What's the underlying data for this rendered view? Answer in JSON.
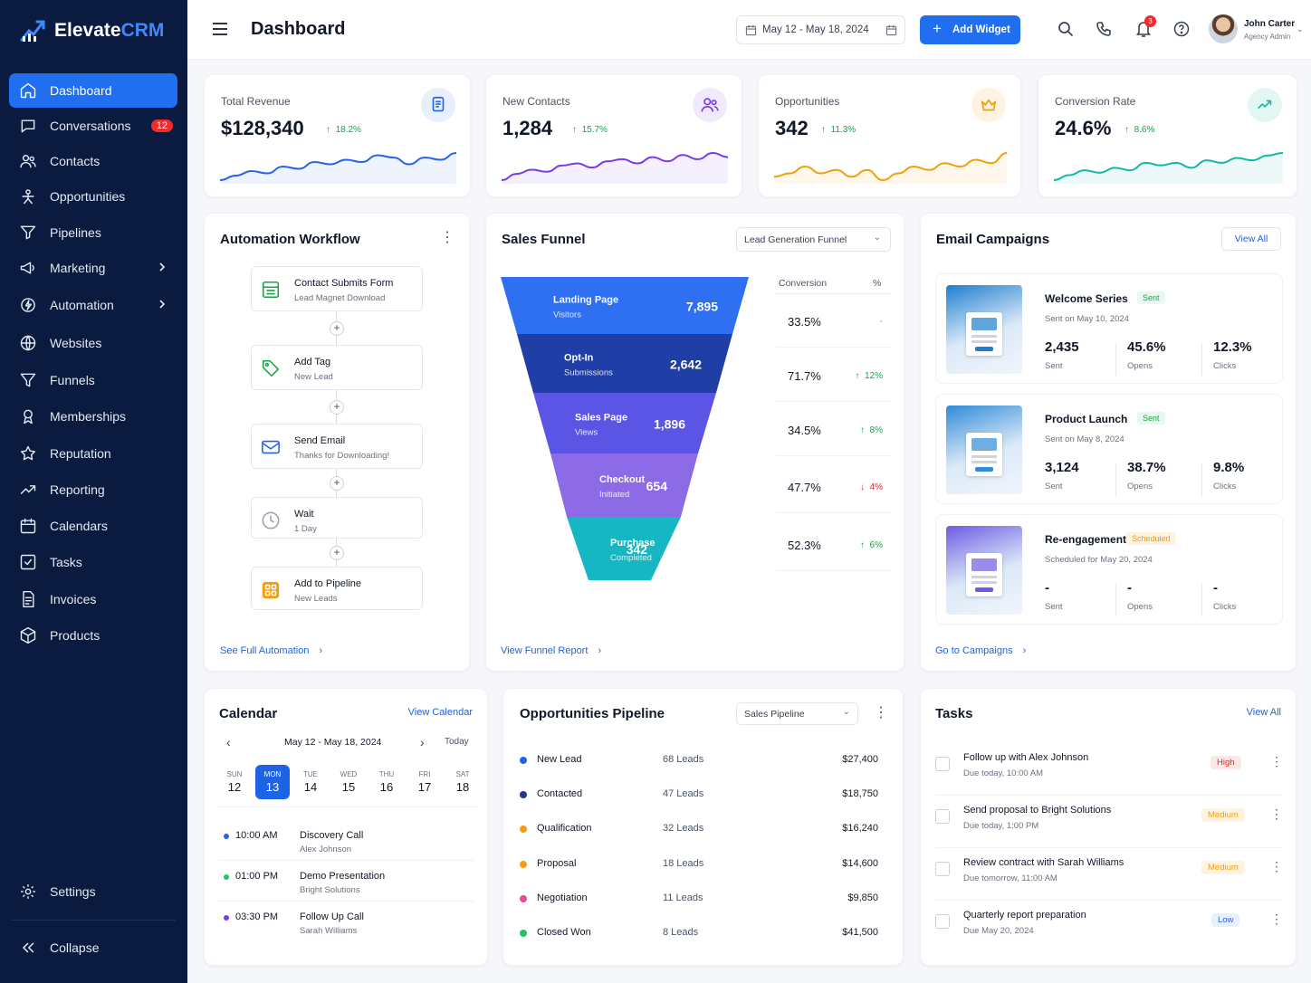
{
  "app": {
    "brand_main": "Elevate",
    "brand_accent": "CRM",
    "accent_color": "#1f6ff0"
  },
  "sidebar": {
    "items": [
      {
        "label": "Dashboard",
        "icon": "home-icon",
        "active": true
      },
      {
        "label": "Conversations",
        "icon": "chat-icon",
        "badge": "12"
      },
      {
        "label": "Contacts",
        "icon": "users-icon"
      },
      {
        "label": "Opportunities",
        "icon": "opportunity-icon"
      },
      {
        "label": "Pipelines",
        "icon": "pipeline-icon"
      },
      {
        "label": "Marketing",
        "icon": "megaphone-icon",
        "expandable": true
      },
      {
        "label": "Automation",
        "icon": "automation-icon",
        "expandable": true
      },
      {
        "label": "Websites",
        "icon": "globe-icon"
      },
      {
        "label": "Funnels",
        "icon": "funnel-icon"
      },
      {
        "label": "Memberships",
        "icon": "membership-icon"
      },
      {
        "label": "Reputation",
        "icon": "star-icon"
      },
      {
        "label": "Reporting",
        "icon": "trend-icon"
      },
      {
        "label": "Calendars",
        "icon": "calendar-icon"
      },
      {
        "label": "Tasks",
        "icon": "checkbox-icon"
      },
      {
        "label": "Invoices",
        "icon": "invoice-icon"
      },
      {
        "label": "Products",
        "icon": "box-icon"
      }
    ],
    "settings": "Settings",
    "collapse": "Collapse"
  },
  "header": {
    "title": "Dashboard",
    "date_range": "May 12 - May 18, 2024",
    "add_widget": "Add Widget",
    "notification_count": "3",
    "user_name": "John Carter",
    "user_role": "Agency Admin"
  },
  "kpis": [
    {
      "label": "Total Revenue",
      "value": "$128,340",
      "delta": "18.2%",
      "color": "#2563eb",
      "icon": "document-icon",
      "trend": [
        3,
        5,
        7,
        6,
        9,
        8,
        11,
        10,
        12,
        11,
        14,
        13,
        10,
        13,
        12,
        15
      ]
    },
    {
      "label": "New Contacts",
      "value": "1,284",
      "delta": "15.7%",
      "color": "#7c3aed",
      "icon": "users-icon",
      "trend": [
        2,
        5,
        7,
        6,
        9,
        10,
        8,
        11,
        12,
        10,
        13,
        11,
        14,
        12,
        15,
        13
      ]
    },
    {
      "label": "Opportunities",
      "value": "342",
      "delta": "11.3%",
      "color": "#f59e0b",
      "icon": "crown-icon",
      "trend": [
        5,
        6,
        8,
        6,
        7,
        5,
        7,
        4,
        6,
        8,
        7,
        9,
        8,
        10,
        9,
        12
      ]
    },
    {
      "label": "Conversion Rate",
      "value": "24.6%",
      "delta": "8.6%",
      "color": "#14b8a6",
      "icon": "trend-up-icon",
      "trend": [
        2,
        4,
        6,
        5,
        7,
        6,
        9,
        8,
        9,
        7,
        10,
        9,
        11,
        10,
        12,
        13
      ]
    }
  ],
  "automation": {
    "title": "Automation Workflow",
    "nodes": [
      {
        "title": "Contact Submits Form",
        "sub": "Lead Magnet Download",
        "icon": "form-icon",
        "color": "#16a34a"
      },
      {
        "title": "Add Tag",
        "sub": "New Lead",
        "icon": "tag-icon",
        "color": "#16a34a"
      },
      {
        "title": "Send Email",
        "sub": "Thanks for Downloading!",
        "icon": "mail-icon",
        "color": "#2563eb"
      },
      {
        "title": "Wait",
        "sub": "1 Day",
        "icon": "clock-icon",
        "color": "#9ca3af"
      },
      {
        "title": "Add to Pipeline",
        "sub": "New Leads",
        "icon": "pipeline-grid-icon",
        "color": "#f59e0b"
      }
    ],
    "link": "See Full Automation"
  },
  "funnel": {
    "title": "Sales Funnel",
    "select": "Lead Generation Funnel",
    "col_conversion": "Conversion",
    "col_pct": "%",
    "stages": [
      {
        "name": "Landing Page",
        "sub": "Visitors",
        "value": "7,895",
        "conversion": "33.5%",
        "delta": "-",
        "dir": "none",
        "color": "#2f6ff2"
      },
      {
        "name": "Opt-In",
        "sub": "Submissions",
        "value": "2,642",
        "conversion": "71.7%",
        "delta": "12%",
        "dir": "up",
        "color": "#1f3fa6"
      },
      {
        "name": "Sales Page",
        "sub": "Views",
        "value": "1,896",
        "conversion": "34.5%",
        "delta": "8%",
        "dir": "up",
        "color": "#5b55e6"
      },
      {
        "name": "Checkout",
        "sub": "Initiated",
        "value": "654",
        "conversion": "47.7%",
        "delta": "4%",
        "dir": "down",
        "color": "#8e6be6"
      },
      {
        "name": "Purchase",
        "sub": "Completed",
        "value": "342",
        "conversion": "52.3%",
        "delta": "6%",
        "dir": "up",
        "color": "#16b6c2"
      }
    ],
    "link": "View Funnel Report"
  },
  "email": {
    "title": "Email Campaigns",
    "view_all": "View All",
    "campaigns": [
      {
        "name": "Welcome Series",
        "badge": "Sent",
        "badge_kind": "sent",
        "date": "Sent on May 10, 2024",
        "sent": "2,435",
        "opens": "45.6%",
        "clicks": "12.3%",
        "l_sent": "Sent",
        "l_opens": "Opens",
        "l_clicks": "Clicks",
        "thumb_color": "#1e7fd0"
      },
      {
        "name": "Product Launch",
        "badge": "Sent",
        "badge_kind": "sent",
        "date": "Sent on May 8, 2024",
        "sent": "3,124",
        "opens": "38.7%",
        "clicks": "9.8%",
        "l_sent": "Sent",
        "l_opens": "Opens",
        "l_clicks": "Clicks",
        "thumb_color": "#2f8bd8"
      },
      {
        "name": "Re-engagement",
        "badge": "Scheduled",
        "badge_kind": "scheduled",
        "date": "Scheduled for May 20, 2024",
        "sent": "-",
        "opens": "-",
        "clicks": "-",
        "l_sent": "Sent",
        "l_opens": "Opens",
        "l_clicks": "Clicks",
        "thumb_color": "#6d5be3"
      }
    ],
    "link": "Go to Campaigns"
  },
  "calendar": {
    "title": "Calendar",
    "view_link": "View Calendar",
    "range": "May 12 - May 18, 2024",
    "today": "Today",
    "days": [
      {
        "dn": "SUN",
        "dd": "12"
      },
      {
        "dn": "MON",
        "dd": "13",
        "selected": true
      },
      {
        "dn": "TUE",
        "dd": "14"
      },
      {
        "dn": "WED",
        "dd": "15"
      },
      {
        "dn": "THU",
        "dd": "16"
      },
      {
        "dn": "FRI",
        "dd": "17"
      },
      {
        "dn": "SAT",
        "dd": "18"
      }
    ],
    "events": [
      {
        "time": "10:00 AM",
        "name": "Discovery Call",
        "sub": "Alex Johnson",
        "color": "#2563eb"
      },
      {
        "time": "01:00 PM",
        "name": "Demo Presentation",
        "sub": "Bright Solutions",
        "color": "#22c55e"
      },
      {
        "time": "03:30 PM",
        "name": "Follow Up Call",
        "sub": "Sarah Williams",
        "color": "#7c3aed"
      }
    ]
  },
  "pipeline": {
    "title": "Opportunities Pipeline",
    "select": "Sales Pipeline",
    "rows": [
      {
        "stage": "New Lead",
        "leads": "68 Leads",
        "value": "$27,400",
        "color": "#2563eb"
      },
      {
        "stage": "Contacted",
        "leads": "47 Leads",
        "value": "$18,750",
        "color": "#1e3a8a"
      },
      {
        "stage": "Qualification",
        "leads": "32 Leads",
        "value": "$16,240",
        "color": "#f59e0b"
      },
      {
        "stage": "Proposal",
        "leads": "18 Leads",
        "value": "$14,600",
        "color": "#f59e0b"
      },
      {
        "stage": "Negotiation",
        "leads": "11 Leads",
        "value": "$9,850",
        "color": "#ec4899"
      },
      {
        "stage": "Closed Won",
        "leads": "8 Leads",
        "value": "$41,500",
        "color": "#22c55e"
      }
    ]
  },
  "tasks": {
    "title": "Tasks",
    "view_all": "View All",
    "items": [
      {
        "title": "Follow up with Alex Johnson",
        "due": "Due today, 10:00 AM",
        "priority": "High",
        "kind": "high"
      },
      {
        "title": "Send proposal to Bright Solutions",
        "due": "Due today, 1:00 PM",
        "priority": "Medium",
        "kind": "medium"
      },
      {
        "title": "Review contract with Sarah Williams",
        "due": "Due tomorrow, 11:00 AM",
        "priority": "Medium",
        "kind": "medium"
      },
      {
        "title": "Quarterly report preparation",
        "due": "Due May 20, 2024",
        "priority": "Low",
        "kind": "low"
      }
    ]
  }
}
